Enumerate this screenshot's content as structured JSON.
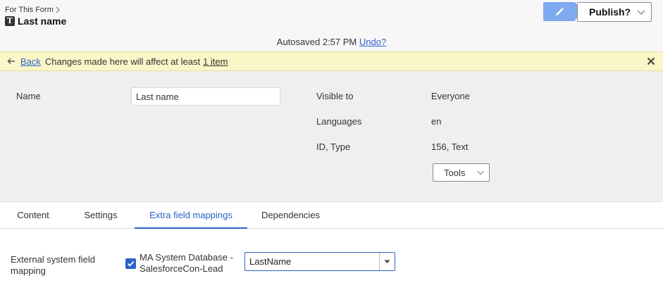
{
  "header": {
    "breadcrumb": "For This Form",
    "type_icon_letter": "T",
    "title": "Last name",
    "publish_label": "Publish?",
    "autosave_text": "Autosaved 2:57 PM",
    "undo_label": "Undo?"
  },
  "notice": {
    "back_label": "Back",
    "message": "Changes made here will affect at least",
    "item_link": "1 item"
  },
  "properties": {
    "name_label": "Name",
    "name_value": "Last name",
    "visible_to_label": "Visible to",
    "visible_to_value": "Everyone",
    "languages_label": "Languages",
    "languages_value": "en",
    "id_type_label": "ID, Type",
    "id_type_value": "156, Text",
    "tools_label": "Tools"
  },
  "tabs": [
    {
      "label": "Content",
      "active": false
    },
    {
      "label": "Settings",
      "active": false
    },
    {
      "label": "Extra field mappings",
      "active": true
    },
    {
      "label": "Dependencies",
      "active": false
    }
  ],
  "mapping": {
    "label": "External system field mapping",
    "source_checked": true,
    "source_label": "MA System Database - SalesforceCon-Lead",
    "field_value": "LastName"
  },
  "colors": {
    "accent": "#2a62c9",
    "edit_button": "#7fa9f0",
    "notice_bg": "#fbf6c7",
    "panel_bg": "#efefef"
  },
  "icons": {
    "edit": "pencil-icon",
    "publish_dropdown": "chevron-down-icon",
    "back": "arrow-left-icon",
    "close": "close-icon",
    "type": "text-type-icon",
    "checkbox": "checkmark-icon",
    "combo_dropdown": "caret-down-icon"
  }
}
